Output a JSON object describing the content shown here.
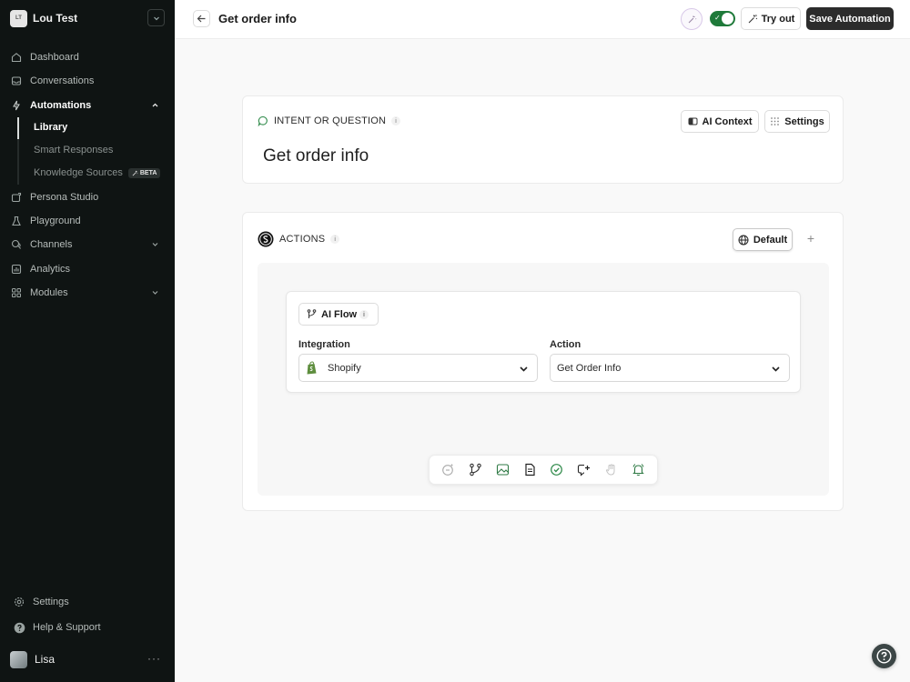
{
  "workspace": {
    "initials": "LT",
    "name": "Lou Test"
  },
  "nav": {
    "items": [
      {
        "label": "Dashboard"
      },
      {
        "label": "Conversations"
      },
      {
        "label": "Automations"
      },
      {
        "label": "Persona Studio"
      },
      {
        "label": "Playground"
      },
      {
        "label": "Channels"
      },
      {
        "label": "Analytics"
      },
      {
        "label": "Modules"
      }
    ],
    "sub_items": [
      {
        "label": "Library"
      },
      {
        "label": "Smart Responses"
      },
      {
        "label": "Knowledge Sources",
        "badge": "BETA"
      }
    ],
    "footer": [
      {
        "label": "Settings"
      },
      {
        "label": "Help & Support"
      }
    ]
  },
  "user": {
    "name": "Lisa",
    "more": "···"
  },
  "header": {
    "title": "Get order info",
    "try_out_label": "Try out",
    "save_label": "Save Automation",
    "enabled": true
  },
  "intent": {
    "section_label": "INTENT OR QUESTION",
    "info": "i",
    "title": "Get order info",
    "ai_context_label": "AI Context",
    "settings_label": "Settings"
  },
  "actions": {
    "section_label": "ACTIONS",
    "info": "i",
    "default_label": "Default",
    "add_label": "+",
    "flow": {
      "tag_label": "AI Flow",
      "tag_info": "i",
      "integration_label": "Integration",
      "integration_value": "Shopify",
      "action_label": "Action",
      "action_value": "Get Order Info"
    },
    "toolbar_tools": [
      "ai-message-icon",
      "branch-icon",
      "image-icon",
      "document-icon",
      "check-circle-icon",
      "tag-plus-icon",
      "hand-icon",
      "bell-icon"
    ]
  },
  "colors": {
    "sidebar_bg": "#0f1413",
    "accent_green": "#1f7a3a",
    "save_button_bg": "#2c2c2c",
    "shopify_green": "#5e8e3e"
  }
}
